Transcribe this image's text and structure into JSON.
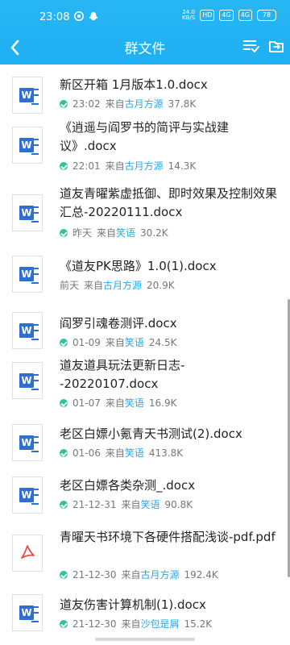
{
  "status": {
    "time": "23:08",
    "speed_value": "24.0",
    "speed_unit": "KB/S",
    "hd": "HD",
    "sig1": "4G",
    "sig2": "4G",
    "battery": "78"
  },
  "header": {
    "title": "群文件"
  },
  "colors": {
    "header": "#1fb0f4",
    "sender": "#2aa7e8",
    "check": "#2ac39b",
    "word": "#2e6fcf",
    "pdf": "#e54b48"
  },
  "files": [
    {
      "name": "新区开箱 1月版本1.0.docx",
      "time": "23:02",
      "sender_prefix": "来自",
      "sender": "古月方源",
      "size": "37.8K",
      "type": "word",
      "downloaded": true
    },
    {
      "name": "《逍遥与阎罗书的简评与实战建议》.docx",
      "time": "22:01",
      "sender_prefix": "来自",
      "sender": "古月方源",
      "size": "14.3K",
      "type": "word",
      "downloaded": true
    },
    {
      "name": "道友青曜紫虚抵御、即时效果及控制效果汇总-20220111.docx",
      "time": "昨天",
      "sender_prefix": "来自",
      "sender": "笑语",
      "size": "30.2K",
      "type": "word",
      "downloaded": true
    },
    {
      "name": "《道友PK思路》1.0(1).docx",
      "time": "前天",
      "sender_prefix": "来自",
      "sender": "古月方源",
      "size": "20.9K",
      "type": "word",
      "downloaded": false
    },
    {
      "name": "阎罗引魂卷测评.docx",
      "time": "01-09",
      "sender_prefix": "来自",
      "sender": "笑语",
      "size": "24.5K",
      "type": "word",
      "downloaded": true
    },
    {
      "name": "道友道具玩法更新日志--20220107.docx",
      "time": "01-07",
      "sender_prefix": "来自",
      "sender": "笑语",
      "size": "16.9K",
      "type": "word",
      "downloaded": true
    },
    {
      "name": "老区白嫖小氪青天书测试(2).docx",
      "time": "01-06",
      "sender_prefix": "来自",
      "sender": "笑语",
      "size": "413.8K",
      "type": "word",
      "downloaded": true
    },
    {
      "name": "老区白嫖各类杂测_.docx",
      "time": "21-12-31",
      "sender_prefix": "来自",
      "sender": "笑语",
      "size": "90.8K",
      "type": "word",
      "downloaded": true
    },
    {
      "name": "青曜天书环境下各硬件搭配浅谈-pdf.pdf",
      "time": "21-12-30",
      "sender_prefix": "来自",
      "sender": "古月方源",
      "size": "192.4K",
      "type": "pdf",
      "downloaded": true
    },
    {
      "name": "道友伤害计算机制(1).docx",
      "time": "21-12-30",
      "sender_prefix": "来自",
      "sender": "沙包是屑",
      "size": "15.2K",
      "type": "word",
      "downloaded": true
    }
  ]
}
